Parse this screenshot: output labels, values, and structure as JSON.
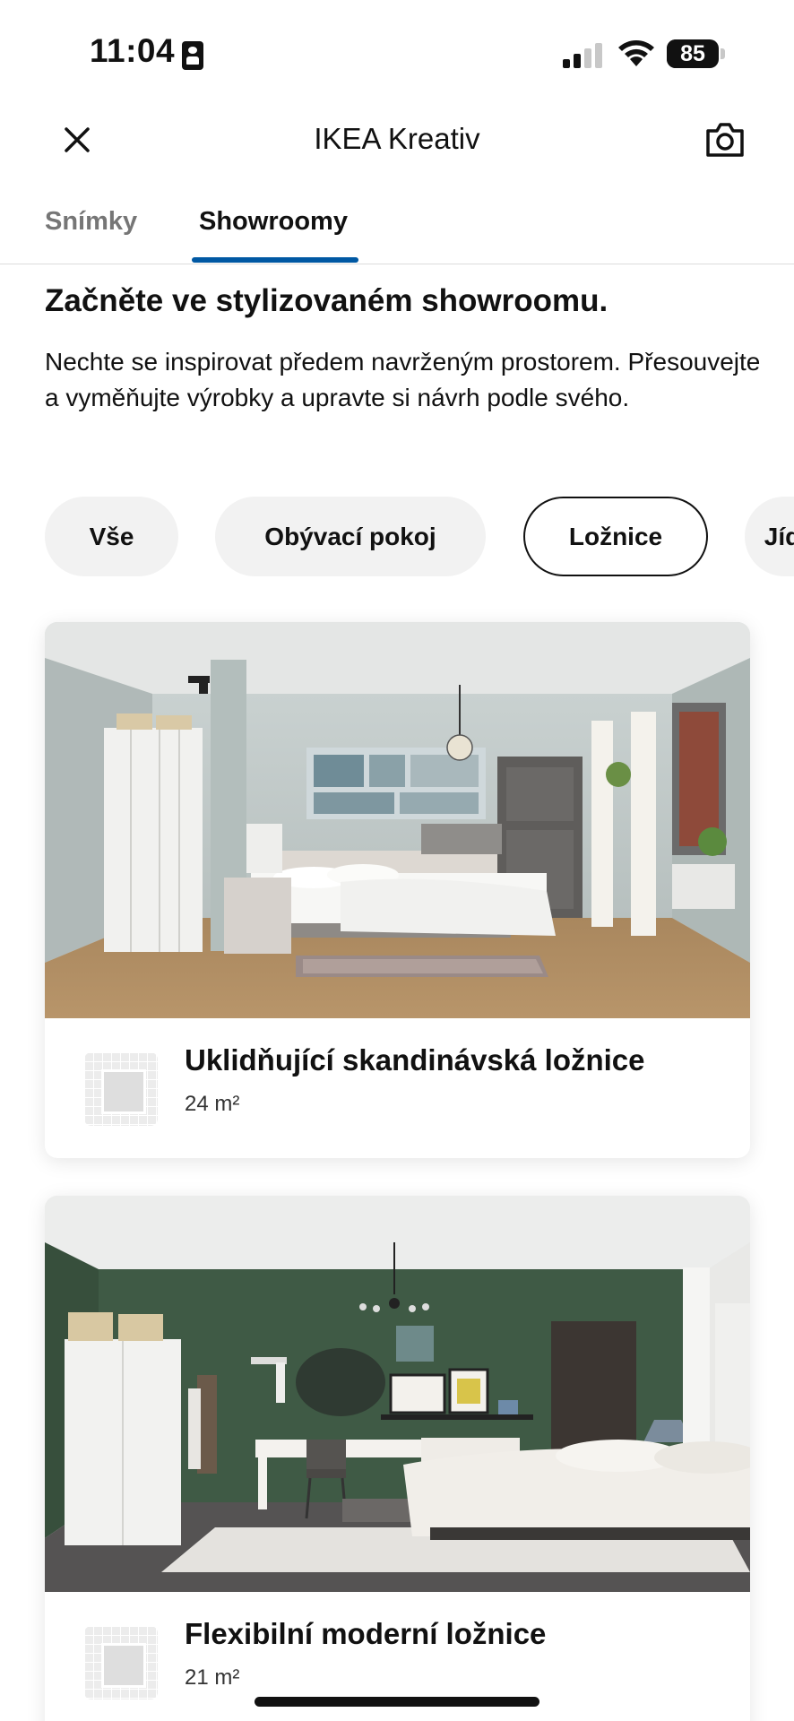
{
  "status_bar": {
    "time": "11:04",
    "battery": "85",
    "battery_fraction": 0.85
  },
  "header": {
    "title": "IKEA Kreativ",
    "close_icon": "close-icon",
    "camera_icon": "camera-icon"
  },
  "tabs": [
    {
      "label": "Snímky",
      "active": false
    },
    {
      "label": "Showroomy",
      "active": true
    }
  ],
  "intro": {
    "title": "Začněte ve stylizovaném showroomu.",
    "text": "Nechte se inspirovat předem navrženým prostorem. Přesouvejte a vyměňujte výrobky a upravte si návrh podle svého."
  },
  "filters": [
    {
      "label": "Vše",
      "selected": false
    },
    {
      "label": "Obývací pokoj",
      "selected": false
    },
    {
      "label": "Ložnice",
      "selected": true
    },
    {
      "label": "Jídelna",
      "selected": false
    }
  ],
  "showrooms": [
    {
      "title": "Uklidňující skandinávská ložnice",
      "area": "24 m²",
      "icon": "floorplan-icon"
    },
    {
      "title": "Flexibilní moderní ložnice",
      "area": "21 m²",
      "icon": "floorplan-icon"
    }
  ],
  "colors": {
    "accent": "#0058a3",
    "chip_bg": "#f2f2f2",
    "text": "#111111",
    "muted": "#767676"
  }
}
